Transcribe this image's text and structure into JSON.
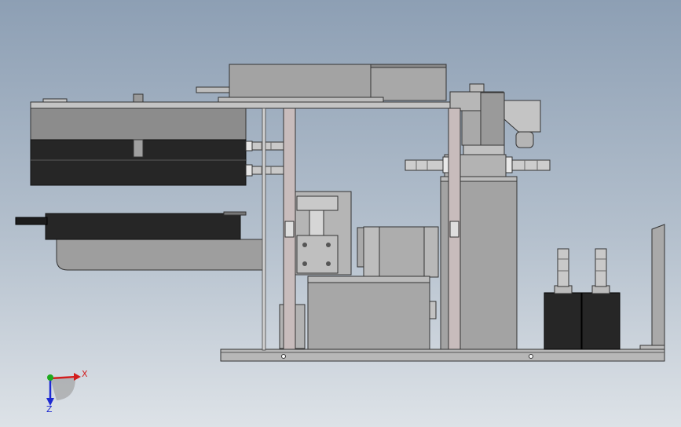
{
  "viewport": {
    "background_top": "#8d9fb4",
    "background_bottom": "#dde2e7"
  },
  "triad": {
    "x_label": "X",
    "z_label": "Z",
    "x_color": "#d21e1e",
    "y_color": "#1eaa1e",
    "z_color": "#1e2ad2"
  }
}
